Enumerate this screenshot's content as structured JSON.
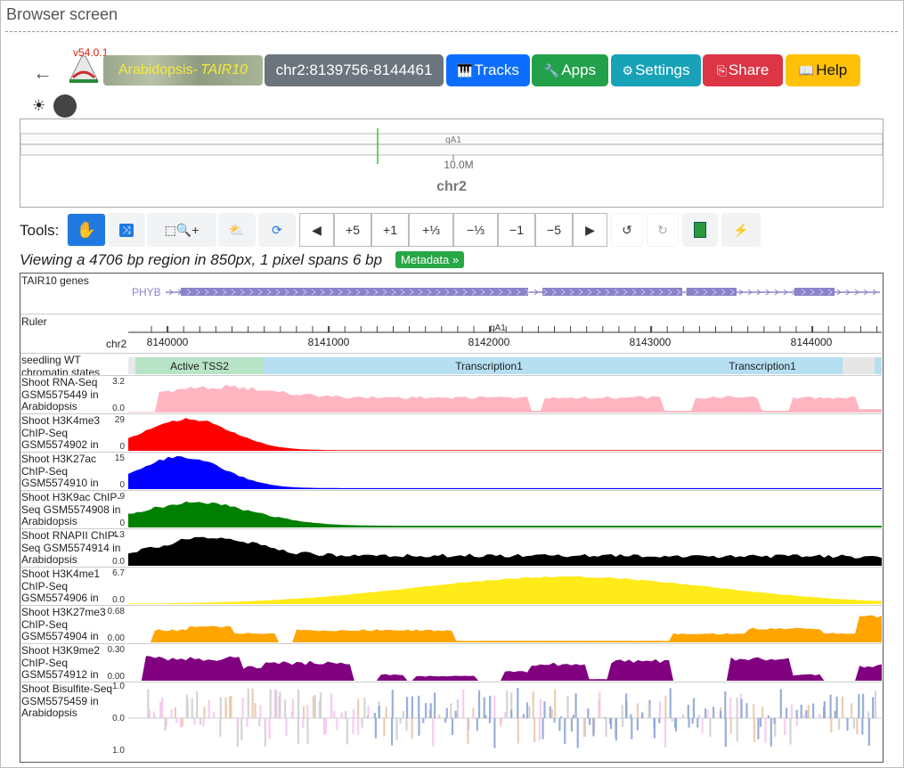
{
  "window_title": "Browser screen",
  "app": {
    "version": "v54.0.1",
    "genome_prefix": "Arabidopsis-",
    "genome_name": "TAIR10"
  },
  "buttons": {
    "back": "←",
    "location": "chr2:8139756-8144461",
    "tracks": "Tracks",
    "apps": "Apps",
    "settings": "Settings",
    "share": "Share",
    "help": "Help"
  },
  "icons": {
    "tracks": "piano-icon",
    "apps": "wrench-icon",
    "settings": "gear-icon",
    "share": "share-icon",
    "help": "book-icon",
    "theme": "sun-icon"
  },
  "overview": {
    "band": "qA1",
    "position": "10.0M",
    "chromosome": "chr2"
  },
  "tools": {
    "label": "Tools:",
    "nav": [
      "+5",
      "+1",
      "+⅓",
      "−⅓",
      "−1",
      "−5"
    ]
  },
  "viewing": {
    "text": "Viewing a 4706 bp region in 850px, 1 pixel spans 6 bp",
    "metadata": "Metadata »"
  },
  "tracks": {
    "genes": {
      "label": "TAIR10 genes",
      "gene": "PHYB"
    },
    "ruler": {
      "label": "Ruler",
      "chr": "chr2",
      "band": "qA1",
      "ticks": [
        "8140000",
        "8141000",
        "8142000",
        "8143000",
        "8144000"
      ]
    },
    "chromatin": {
      "label": "seedling WT chromatin states",
      "segments": [
        "Active TSS2",
        "Transcription1",
        "Transcription1"
      ]
    },
    "signals": [
      {
        "label": "Shoot RNA-Seq GSM5575449 in Arabidopsis",
        "max": "3.2",
        "min": "0.0",
        "color": "#ffb6c1"
      },
      {
        "label": "Shoot H3K4me3 ChIP-Seq GSM5574902 in Arabidopsis",
        "max": "29",
        "min": "0",
        "color": "#ff0000"
      },
      {
        "label": "Shoot H3K27ac ChIP-Seq GSM5574910 in Arabidopsis",
        "max": "15",
        "min": "0",
        "color": "#0000ff"
      },
      {
        "label": "Shoot H3K9ac ChIP-Seq GSM5574908 in Arabidopsis",
        "max": "9",
        "min": "0",
        "color": "#008000"
      },
      {
        "label": "Shoot RNAPII ChIP-Seq GSM5574914 in Arabidopsis",
        "max": "4.3",
        "min": "0.0",
        "color": "#000000"
      },
      {
        "label": "Shoot H3K4me1 ChIP-Seq GSM5574906 in Arabidopsis",
        "max": "6.7",
        "min": "0.0",
        "color": "#ffeb1a"
      },
      {
        "label": "Shoot H3K27me3 ChIP-Seq GSM5574904 in Arabidopsis",
        "max": "0.68",
        "min": "0.00",
        "color": "#ffa500"
      },
      {
        "label": "Shoot H3K9me2 ChIP-Seq GSM5574912 in Arabidopsis",
        "max": "0.30",
        "min": "0.00",
        "color": "#800080"
      }
    ],
    "methyl": {
      "label": "Shoot Bisulfite-Seq GSM5575459 in Arabidopsis",
      "top": "1.0",
      "mid": "0.0",
      "bottom": "1.0"
    }
  }
}
